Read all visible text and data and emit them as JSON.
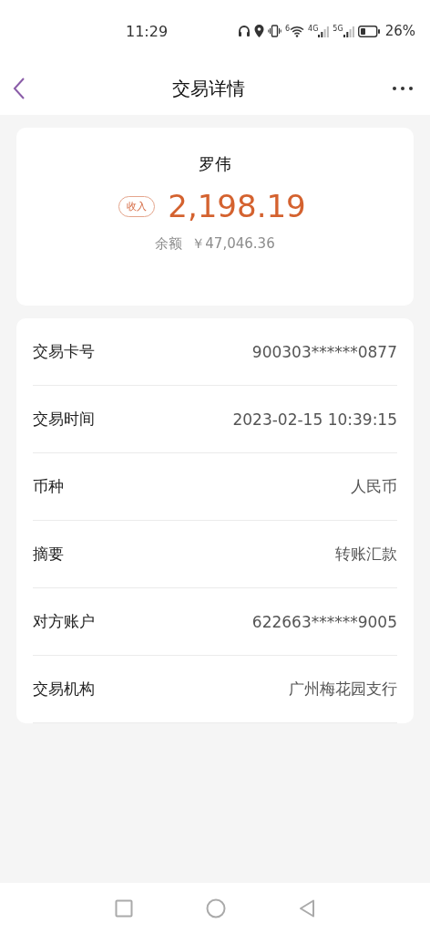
{
  "status_bar": {
    "time": "11:29",
    "wifi_label": "6",
    "signal_labels": [
      "4G",
      "5G"
    ],
    "battery_percent": "26%"
  },
  "header": {
    "title": "交易详情"
  },
  "summary": {
    "name": "罗伟",
    "badge": "收入",
    "amount": "2,198.19",
    "balance_label": "余额",
    "balance": "￥47,046.36"
  },
  "details": [
    {
      "label": "交易卡号",
      "value": "900303******0877"
    },
    {
      "label": "交易时间",
      "value": "2023-02-15 10:39:15"
    },
    {
      "label": "币种",
      "value": "人民币"
    },
    {
      "label": "摘要",
      "value": "转账汇款"
    },
    {
      "label": "对方账户",
      "value": "622663******9005"
    },
    {
      "label": "交易机构",
      "value": "广州梅花园支行"
    }
  ]
}
